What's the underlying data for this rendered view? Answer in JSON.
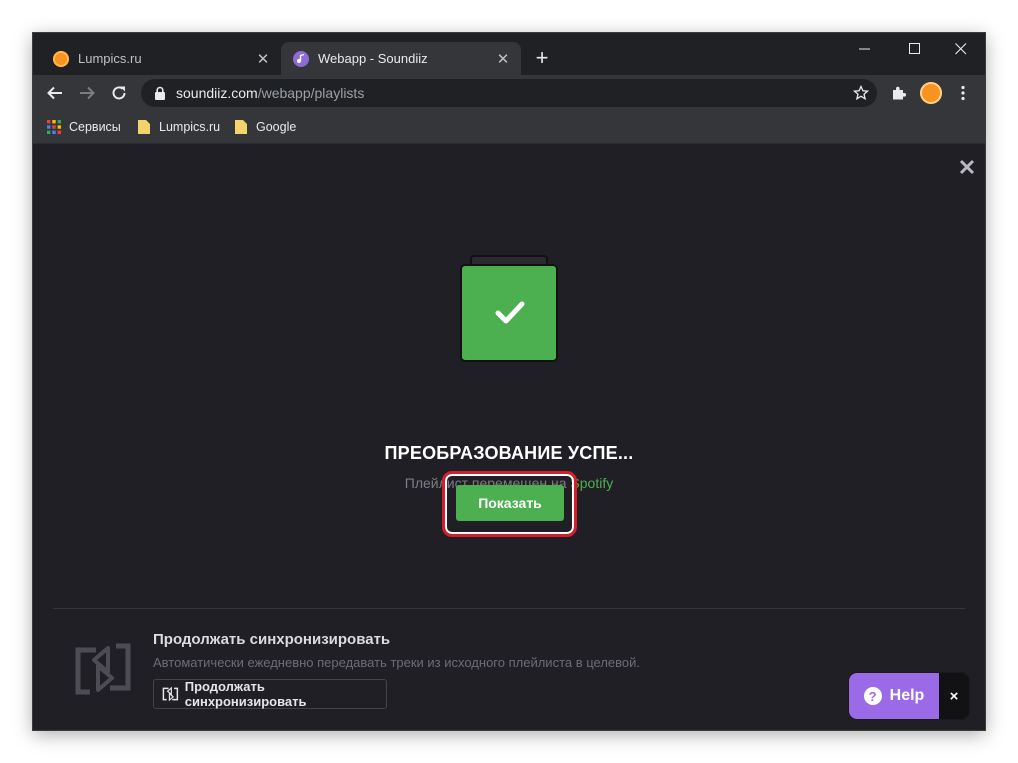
{
  "browser": {
    "tabs": [
      {
        "title": "Lumpics.ru",
        "active": false,
        "favicon": "orange-icon"
      },
      {
        "title": "Webapp - Soundiiz",
        "active": true,
        "favicon": "soundiiz-icon"
      }
    ],
    "url_domain": "soundiiz.com",
    "url_path": "/webapp/playlists",
    "bookmarks": [
      {
        "label": "Сервисы",
        "icon": "apps-grid-icon"
      },
      {
        "label": "Lumpics.ru",
        "icon": "folder-icon"
      },
      {
        "label": "Google",
        "icon": "folder-icon"
      }
    ]
  },
  "dialog": {
    "heading": "ПРЕОБРАЗОВАНИЕ УСПЕ...",
    "subtitle_prefix": "Плейлист перемещен на ",
    "subtitle_target": "Spotify",
    "show_button": "Показать"
  },
  "sync": {
    "title": "Продолжать синхронизировать",
    "description": "Автоматически ежедневно передавать треки из исходного плейлиста в целевой.",
    "button": "Продолжать синхронизировать"
  },
  "help": {
    "label": "Help",
    "close": "×"
  },
  "colors": {
    "accent_green": "#4caf50",
    "help_purple": "#9b6ae6",
    "highlight_red": "#d21f2a"
  }
}
